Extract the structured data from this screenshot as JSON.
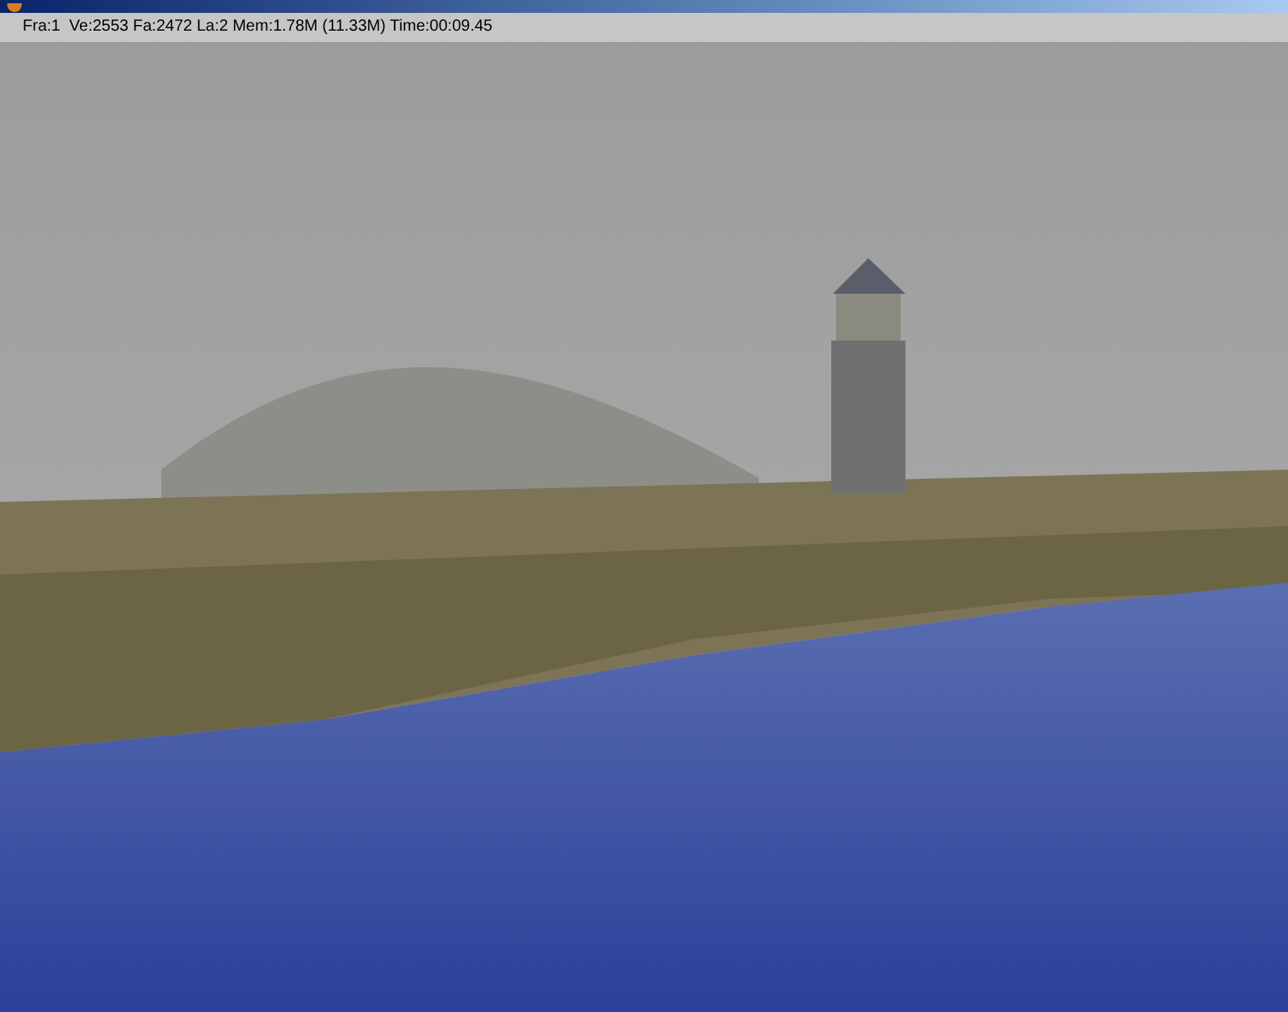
{
  "window": {
    "title_bar": true
  },
  "status_bar": {
    "text": "Fra:1  Ve:2553 Fa:2472 La:2 Mem:1.78M (11.33M) Time:00:09.45"
  },
  "render": {
    "kind": "scene"
  }
}
